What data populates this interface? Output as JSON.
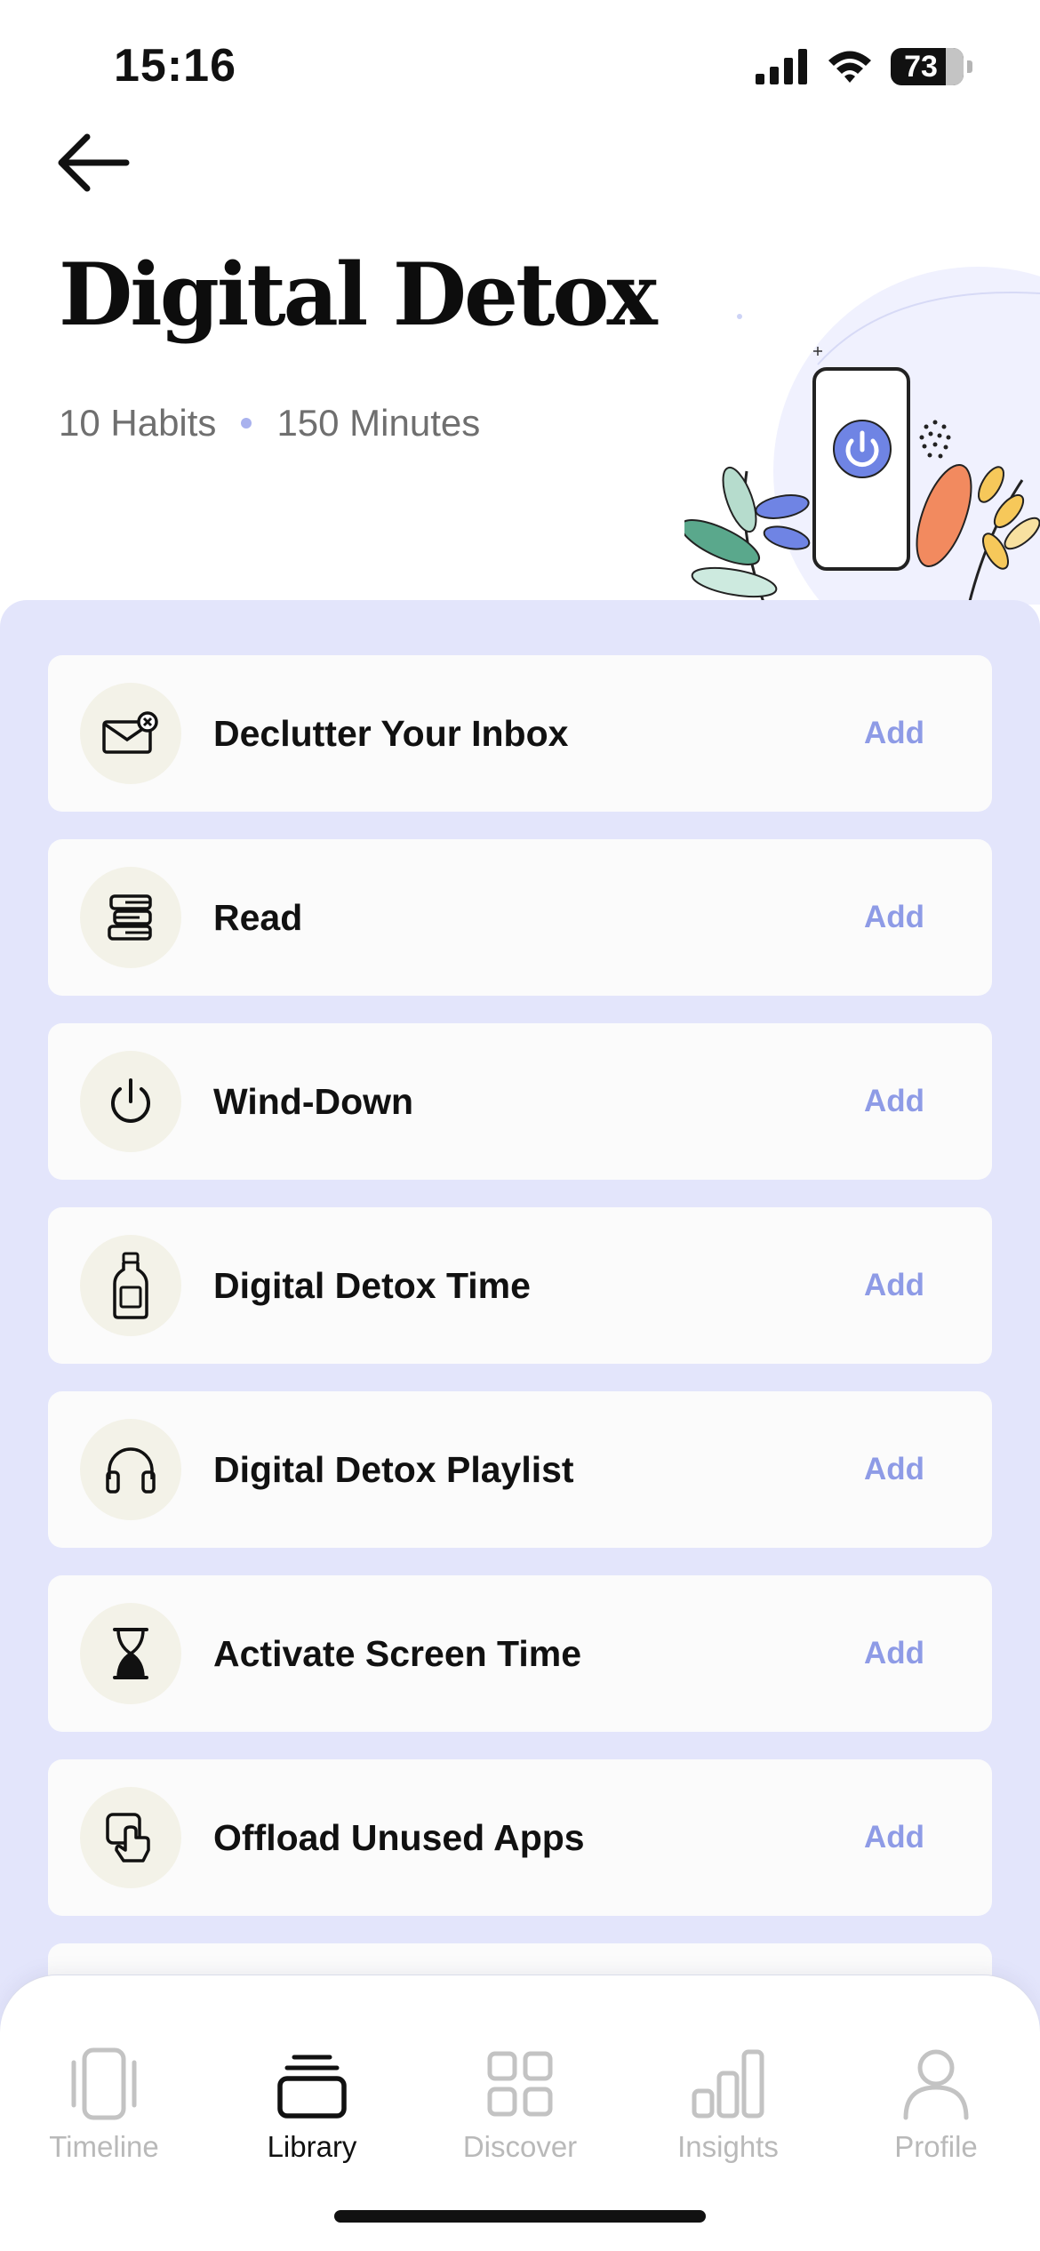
{
  "status_bar": {
    "time": "15:16",
    "battery_level": "73"
  },
  "header": {
    "title": "Digital Detox",
    "habits_count": "10 Habits",
    "duration": "150 Minutes"
  },
  "habits": [
    {
      "name": "Declutter Your Inbox",
      "icon": "envelope-x-icon",
      "action": "Add"
    },
    {
      "name": "Read",
      "icon": "books-icon",
      "action": "Add"
    },
    {
      "name": "Wind-Down",
      "icon": "power-icon",
      "action": "Add"
    },
    {
      "name": "Digital Detox Time",
      "icon": "bottle-icon",
      "action": "Add"
    },
    {
      "name": "Digital Detox Playlist",
      "icon": "headphones-icon",
      "action": "Add"
    },
    {
      "name": "Activate Screen Time",
      "icon": "hourglass-icon",
      "action": "Add"
    },
    {
      "name": "Offload Unused Apps",
      "icon": "hand-tap-icon",
      "action": "Add"
    }
  ],
  "tab_bar": {
    "active": "Library",
    "tabs": [
      {
        "label": "Timeline",
        "icon": "timeline-icon"
      },
      {
        "label": "Library",
        "icon": "library-icon"
      },
      {
        "label": "Discover",
        "icon": "grid-icon"
      },
      {
        "label": "Insights",
        "icon": "bar-chart-icon"
      },
      {
        "label": "Profile",
        "icon": "person-icon"
      }
    ]
  },
  "colors": {
    "panel_bg": "#e3e5fb",
    "accent": "#8e9be6",
    "icon_circle": "#f3f2e8"
  }
}
